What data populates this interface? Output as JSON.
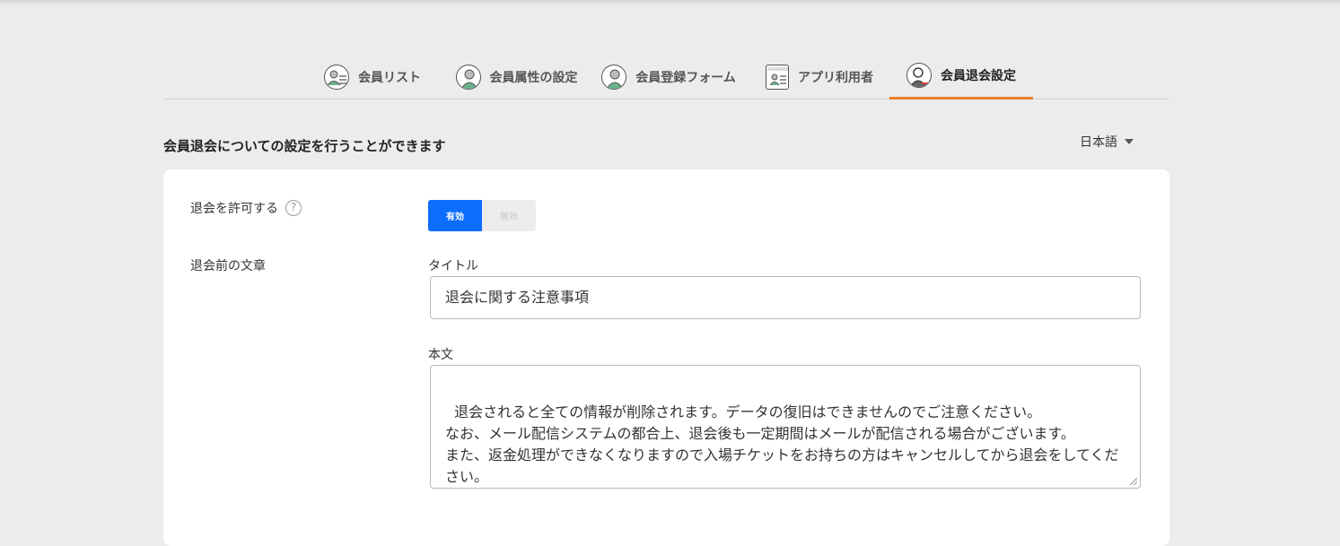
{
  "tabs": [
    {
      "label": "会員リスト",
      "icon": "member-list-icon"
    },
    {
      "label": "会員属性の設定",
      "icon": "member-attribute-icon"
    },
    {
      "label": "会員登録フォーム",
      "icon": "member-form-icon"
    },
    {
      "label": "アプリ利用者",
      "icon": "app-user-icon"
    },
    {
      "label": "会員退会設定",
      "icon": "member-withdraw-icon"
    }
  ],
  "active_tab": "会員退会設定",
  "accent_color": "#ef7f2d",
  "primary_color": "#0d6efd",
  "page": {
    "subtitle": "会員退会についての設定を行うことができます",
    "language": "日本語"
  },
  "settings": {
    "allow_label": "退会を許可する",
    "help_glyph": "?",
    "toggle_on": "有効",
    "toggle_off": "無効",
    "toggle_value": "有効",
    "pre_text_label": "退会前の文章",
    "title_label": "タイトル",
    "title_value": "退会に関する注意事項",
    "body_label": "本文",
    "body_value": "退会されると全ての情報が削除されます。データの復旧はできませんのでご注意ください。\nなお、メール配信システムの都合上、退会後も一定期間はメールが配信される場合がございます。\nまた、返金処理ができなくなりますので入場チケットをお持ちの方はキャンセルしてから退会をしてください。"
  }
}
